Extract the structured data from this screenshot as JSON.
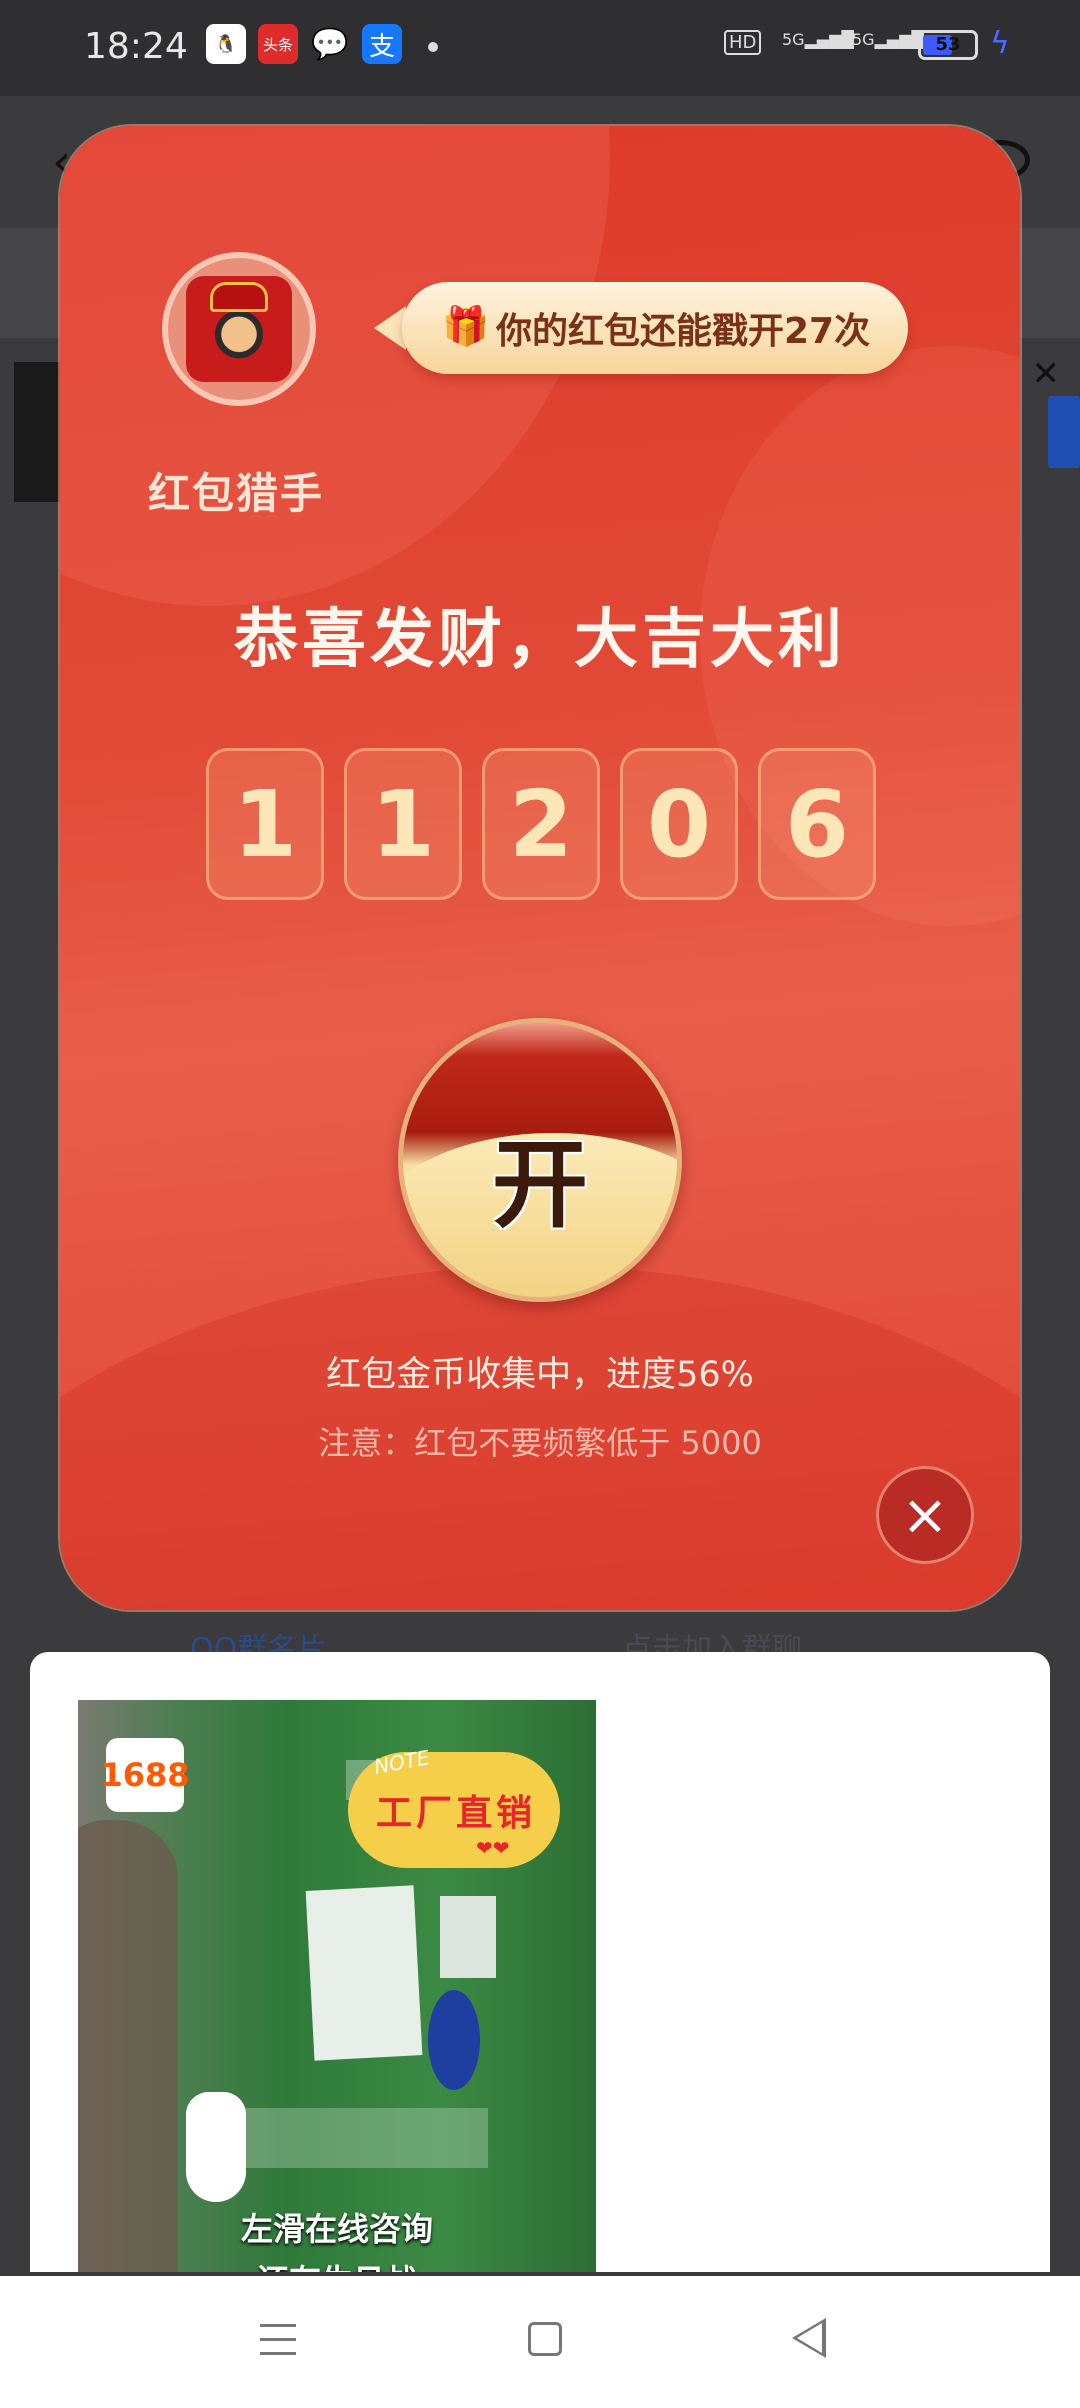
{
  "status_bar": {
    "time": "18:24",
    "apps": [
      "qq-icon",
      "toutiao-icon",
      "wechat-icon",
      "alipay-icon"
    ],
    "toutiao_label": "头条",
    "alipay_label": "支",
    "hd_label": "HD",
    "signal1": "5G",
    "signal2": "5G",
    "battery": "53",
    "battery_level": 0.53
  },
  "background": {
    "left_text": "QQ群名片",
    "right_text": "点击加入群聊"
  },
  "red_packet": {
    "nickname": "红包猎手",
    "bubble_text": "你的红包还能戳开27次",
    "headline": "恭喜发财，大吉大利",
    "digits": [
      "1",
      "1",
      "2",
      "0",
      "6"
    ],
    "open_label": "开",
    "progress_text": "红包金币收集中，进度56%",
    "notice_text": "注意：红包不要频繁低于 5000",
    "close_label": "×"
  },
  "ad": {
    "logo": "1688",
    "note_label": "NOTE",
    "note_text": "工厂直销",
    "caption": "左滑在线咨询",
    "caption2": "还有生见战"
  },
  "colors": {
    "packet_red": "#e14a37",
    "gold": "#fde7b8",
    "brand_1688": "#ff5a00"
  }
}
